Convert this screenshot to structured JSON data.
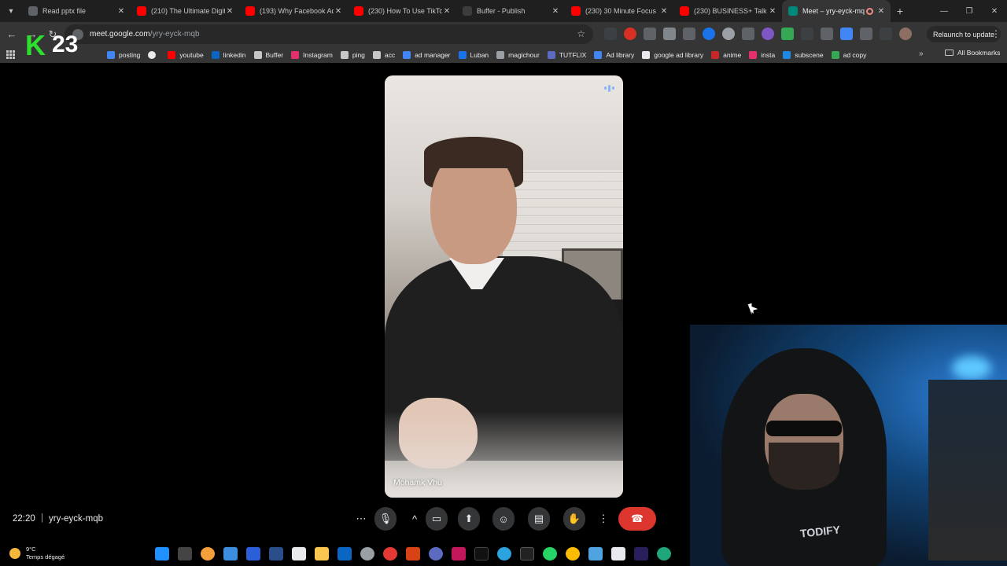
{
  "browser": {
    "tabs": [
      {
        "title": "Read pptx file",
        "fav_color": "#5f6368",
        "active": false
      },
      {
        "title": "(210) The Ultimate Digit",
        "fav_color": "#ff0000",
        "active": false
      },
      {
        "title": "(193) Why Facebook Ad",
        "fav_color": "#ff0000",
        "active": false
      },
      {
        "title": "(230) How To Use TikTok",
        "fav_color": "#ff0000",
        "active": false
      },
      {
        "title": "Buffer - Publish",
        "fav_color": "#3c3c3c",
        "active": false
      },
      {
        "title": "(230) 30 Minute Focus",
        "fav_color": "#ff0000",
        "active": false
      },
      {
        "title": "(230) BUSINESS+ Talk #",
        "fav_color": "#ff0000",
        "active": false
      },
      {
        "title": "Meet – yry-eyck-mq",
        "fav_color": "#00897b",
        "active": true
      }
    ],
    "url_host": "meet.google.com",
    "url_path": "/yry-eyck-mqb",
    "relaunch_label": "Relaunch to update",
    "bookmarks": [
      {
        "label": "posting",
        "color": "#4285f4"
      },
      {
        "label": "",
        "color": "#e8eaed"
      },
      {
        "label": "youtube",
        "color": "#ff0000"
      },
      {
        "label": "linkedin",
        "color": "#0a66c2"
      },
      {
        "label": "Buffer",
        "color": "#c4c7c5"
      },
      {
        "label": "Instagram",
        "color": "#e1306c"
      },
      {
        "label": "ping",
        "color": "#c4c7c5"
      },
      {
        "label": "acc",
        "color": "#c4c7c5"
      },
      {
        "label": "ad manager",
        "color": "#4285f4"
      },
      {
        "label": "Luban",
        "color": "#1a73e8"
      },
      {
        "label": "magichour",
        "color": "#9aa0a6"
      },
      {
        "label": "TUTFLIX",
        "color": "#5c6bc0"
      },
      {
        "label": "Ad library",
        "color": "#4285f4"
      },
      {
        "label": "google ad library",
        "color": "#e8eaed"
      },
      {
        "label": "anime",
        "color": "#c62828"
      },
      {
        "label": "insta",
        "color": "#e1306c"
      },
      {
        "label": "subscene",
        "color": "#1e88e5"
      },
      {
        "label": "ad copy",
        "color": "#34a853"
      }
    ],
    "all_bookmarks_label": "All Bookmarks"
  },
  "overlay_logo": {
    "letter": "K",
    "number": "23"
  },
  "meet": {
    "participant_name": "Mohamk Vhu",
    "clock": "22:20",
    "separator": "|",
    "meeting_code": "yry-eyck-mqb",
    "self_view_shirt_logo": "TODIFY",
    "controls": [
      {
        "name": "more-options-button",
        "icon": "⋯",
        "width": 28
      },
      {
        "name": "microphone-button",
        "icon": "🎙",
        "width": 28
      },
      {
        "name": "mic-options-button",
        "icon": "^",
        "width": 22
      },
      {
        "name": "camera-button",
        "icon": "▭",
        "width": 28
      },
      {
        "name": "present-screen-button",
        "icon": "⬆",
        "width": 28
      },
      {
        "name": "emoji-reaction-button",
        "icon": "☺",
        "width": 28
      },
      {
        "name": "captions-button",
        "icon": "▤",
        "width": 28
      },
      {
        "name": "raise-hand-button",
        "icon": "✋",
        "width": 28
      },
      {
        "name": "more-actions-button",
        "icon": "⋮",
        "width": 20
      },
      {
        "name": "leave-call-button",
        "icon": "☎",
        "width": 48
      }
    ]
  },
  "taskbar": {
    "temperature": "9°C",
    "weather_text": "Temps dégagé"
  }
}
